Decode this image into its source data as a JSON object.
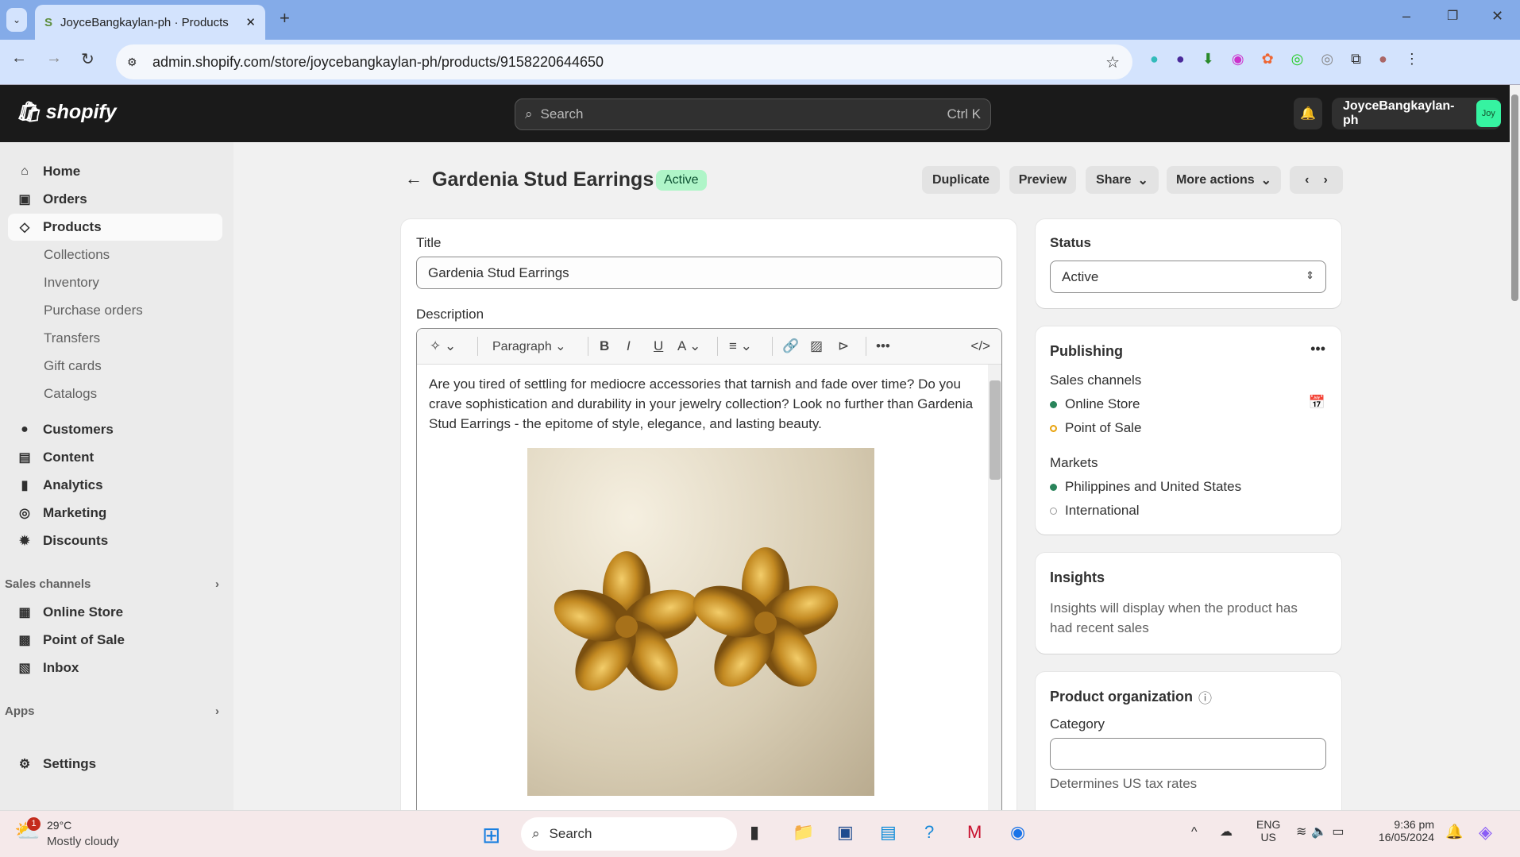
{
  "browser": {
    "tab_title": "JoyceBangkaylan-ph · Products",
    "url": "admin.shopify.com/store/joycebangkaylan-ph/products/9158220644650"
  },
  "header": {
    "logo": "shopify",
    "search_placeholder": "Search",
    "search_shortcut": "Ctrl K",
    "store_name": "JoyceBangkaylan-ph",
    "avatar": "Joy"
  },
  "sidebar": {
    "items": [
      {
        "label": "Home",
        "icon": "home-icon"
      },
      {
        "label": "Orders",
        "icon": "orders-icon"
      },
      {
        "label": "Products",
        "icon": "tag-icon"
      },
      {
        "label": "Collections"
      },
      {
        "label": "Inventory"
      },
      {
        "label": "Purchase orders"
      },
      {
        "label": "Transfers"
      },
      {
        "label": "Gift cards"
      },
      {
        "label": "Catalogs"
      },
      {
        "label": "Customers",
        "icon": "person-icon"
      },
      {
        "label": "Content",
        "icon": "content-icon"
      },
      {
        "label": "Analytics",
        "icon": "chart-icon"
      },
      {
        "label": "Marketing",
        "icon": "target-icon"
      },
      {
        "label": "Discounts",
        "icon": "discount-icon"
      }
    ],
    "sales_channels_heading": "Sales channels",
    "channels": [
      {
        "label": "Online Store"
      },
      {
        "label": "Point of Sale"
      },
      {
        "label": "Inbox"
      }
    ],
    "apps_heading": "Apps",
    "settings": "Settings"
  },
  "page": {
    "title": "Gardenia Stud Earrings",
    "status_badge": "Active",
    "actions": {
      "duplicate": "Duplicate",
      "preview": "Preview",
      "share": "Share",
      "more": "More actions"
    }
  },
  "form": {
    "title_label": "Title",
    "title_value": "Gardenia Stud Earrings",
    "description_label": "Description",
    "paragraph": "Paragraph",
    "description_text": "Are you tired of settling for mediocre accessories that tarnish and fade over time? Do you crave sophistication and durability in your jewelry collection? Look no further than Gardenia Stud Earrings - the epitome of style, elegance, and lasting beauty."
  },
  "status_card": {
    "heading": "Status",
    "value": "Active"
  },
  "publishing": {
    "heading": "Publishing",
    "sales_channels_label": "Sales channels",
    "channels": [
      "Online Store",
      "Point of Sale"
    ],
    "markets_label": "Markets",
    "markets": [
      "Philippines and United States",
      "International"
    ],
    "colors": {
      "active": "#29845a",
      "inactive": "#e8a20c"
    }
  },
  "insights": {
    "heading": "Insights",
    "text": "Insights will display when the product has had recent sales"
  },
  "organization": {
    "heading": "Product organization",
    "category_label": "Category",
    "category_value": "",
    "help": "Determines US tax rates"
  },
  "taskbar": {
    "temp": "29°C",
    "weather": "Mostly cloudy",
    "badge": "1",
    "search": "Search",
    "lang1": "ENG",
    "lang2": "US",
    "time": "9:36 pm",
    "date": "16/05/2024"
  }
}
